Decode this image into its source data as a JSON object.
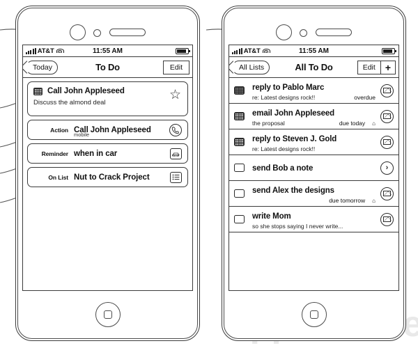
{
  "watermark": "AppleInsider",
  "phones": [
    {
      "id": "left",
      "status": {
        "carrier": "AT&T",
        "time": "11:55 AM"
      },
      "nav": {
        "back": "Today",
        "title": "To Do",
        "edit": "Edit"
      },
      "cards": [
        {
          "kind": "detail",
          "icon": "grid-checkbox-icon",
          "title": "Call John Appleseed",
          "subtitle": "Discuss the almond deal",
          "accessory": "star-icon",
          "star": "☆"
        },
        {
          "kind": "row",
          "label": "Action",
          "value": "Call John Appleseed",
          "sub": "mobile",
          "accessory": "phone-icon"
        },
        {
          "kind": "row",
          "label": "Reminder",
          "value": "when in car",
          "sub": "",
          "accessory": "car-icon"
        },
        {
          "kind": "row",
          "label": "On List",
          "value": "Nut to Crack Project",
          "sub": "",
          "accessory": "list-icon"
        }
      ]
    },
    {
      "id": "right",
      "status": {
        "carrier": "AT&T",
        "time": "11:55 AM"
      },
      "nav": {
        "back": "All Lists",
        "title": "All To Do",
        "edit": "Edit",
        "add": "+"
      },
      "rows": [
        {
          "checkbox": "grid-shaded",
          "title": "reply to Pablo Marc",
          "subtitle": "re: Latest designs rock!!",
          "due": "overdue",
          "alarm": false,
          "accessory": "mail-icon"
        },
        {
          "checkbox": "grid",
          "title": "email John Appleseed",
          "subtitle": "the proposal",
          "due": "due today",
          "alarm": true,
          "alarm_glyph": "⌂",
          "accessory": "mail-icon"
        },
        {
          "checkbox": "grid",
          "title": "reply to Steven J. Gold",
          "subtitle": "re: Latest designs rock!!",
          "due": "",
          "alarm": false,
          "accessory": "mail-icon"
        },
        {
          "checkbox": "empty",
          "title": "send Bob a note",
          "subtitle": "",
          "due": "",
          "alarm": false,
          "accessory": "chevron-right-icon",
          "chevron": "›"
        },
        {
          "checkbox": "empty",
          "title": "send Alex the designs",
          "subtitle": "",
          "due": "due tomorrow",
          "alarm": true,
          "alarm_glyph": "⌂",
          "accessory": "mail-icon"
        },
        {
          "checkbox": "empty",
          "title": "write Mom",
          "subtitle": "so she stops saying I never write...",
          "due": "",
          "alarm": false,
          "accessory": "mail-icon"
        }
      ]
    }
  ],
  "colors": {
    "ink": "#3a3a3a",
    "text": "#111111",
    "watermark": "#e9e9e9"
  }
}
